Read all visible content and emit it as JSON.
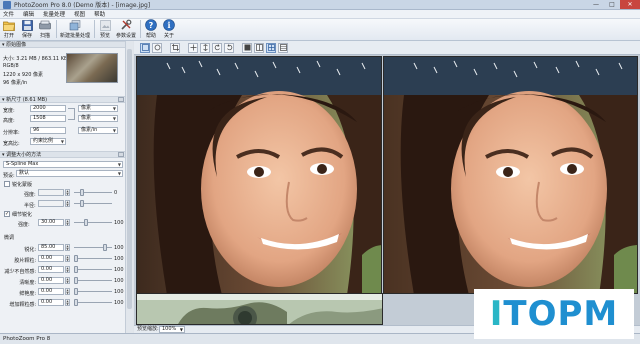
{
  "window": {
    "title": "PhotoZoom Pro 8.0 (Demo 版本) - [image.jpg]",
    "controls": [
      "—",
      "□",
      "✕"
    ]
  },
  "menu": [
    "文件",
    "编辑",
    "批量处理",
    "视图",
    "帮助"
  ],
  "toolbar": {
    "buttons": [
      {
        "label": "打开",
        "icon": "open-folder-icon"
      },
      {
        "label": "保存",
        "icon": "save-icon"
      },
      {
        "label": "扫描",
        "icon": "scan-icon"
      },
      {
        "label": "新建批量处理",
        "icon": "batch-icon"
      },
      {
        "label": "预览",
        "icon": "preview-icon"
      },
      {
        "label": "参数设置",
        "icon": "settings-icon"
      },
      {
        "label": "帮助",
        "icon": "help-icon"
      },
      {
        "label": "关于",
        "icon": "info-icon"
      }
    ]
  },
  "sidebar": {
    "original_header": "原始图像",
    "original_info": [
      "大小: 3.21 MB / 863.11 KB",
      "RGB/8",
      "1220 x 920 像素",
      "96 像素/in"
    ],
    "new_size_header": "新尺寸 (8.61 MB)",
    "width_label": "宽度:",
    "width_value": "2000",
    "height_label": "高度:",
    "height_value": "1508",
    "unit_value": "像素",
    "resolution_label": "分辨率:",
    "resolution_value": "96",
    "res_unit_value": "像素/in",
    "fit_label": "宽高比:",
    "fit_value": "约束比例",
    "method_header": "调整大小的方法",
    "method_value": "S-Spline Max",
    "preset_label": "预设:",
    "preset_value": "默认",
    "unsharp_label": "锐化蒙版",
    "unsharp_strength_label": "强度:",
    "unsharp_radius_label": "半径:",
    "sharp_detail_label": "细节锐化",
    "sharp_strength_label": "强度:",
    "sharp_strength_value": "30.00",
    "sharp_strength_max": "100",
    "fine_tune_label": "微调",
    "rows": [
      {
        "label": "锐化:",
        "value": "85.00",
        "max": "100"
      },
      {
        "label": "胶片颗粒:",
        "value": "0.00",
        "max": "100"
      },
      {
        "label": "减少不自然感:",
        "value": "0.00",
        "max": "100"
      },
      {
        "label": "清晰度:",
        "value": "0.00",
        "max": "100"
      },
      {
        "label": "鲜艳度:",
        "value": "0.00",
        "max": "100"
      },
      {
        "label": "增加颗粒感:",
        "value": "0.00",
        "max": "100"
      }
    ],
    "unsharp_min": "0"
  },
  "viewer": {
    "zoom_label": "预览缩放:",
    "zoom_value": "100%"
  },
  "status": "PhotoZoom Pro 8",
  "watermark": {
    "first": "I",
    "rest": "TOPM"
  }
}
